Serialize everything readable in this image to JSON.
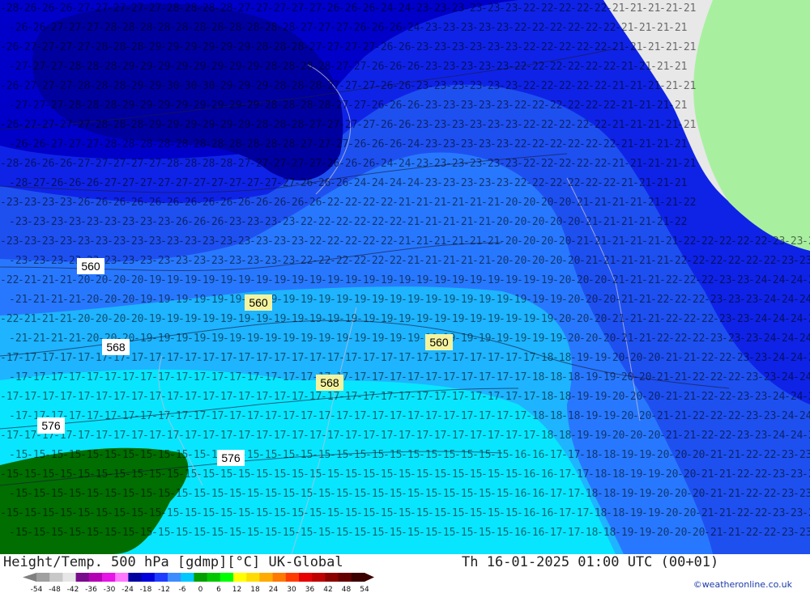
{
  "map": {
    "contour_labels": [
      {
        "text": "560",
        "style": "white"
      },
      {
        "text": "560",
        "style": "yellow"
      },
      {
        "text": "560",
        "style": "yellow"
      },
      {
        "text": "568",
        "style": "white"
      },
      {
        "text": "568",
        "style": "yellow"
      },
      {
        "text": "576",
        "style": "white"
      },
      {
        "text": "576",
        "style": "white"
      }
    ],
    "colors": {
      "temp_m30": "#00009f",
      "temp_m27": "#0000c8",
      "temp_m24": "#0f23e6",
      "temp_m21": "#1e50f0",
      "temp_m18": "#2878ff",
      "temp_m16": "#1eb4ff",
      "temp_m14": "#08e6ff",
      "land_green": "#a8f0a0",
      "land_gray": "#e8e8e8",
      "low_green": "#006e00"
    }
  },
  "footer": {
    "title": "Height/Temp. 500 hPa [gdmp][°C] UK-Global",
    "datetime": "Th 16-01-2025 01:00 UTC (00+01)",
    "credit": "©weatheronline.co.uk"
  },
  "legend": {
    "ticks": [
      "-54",
      "-48",
      "-42",
      "-36",
      "-30",
      "-24",
      "-18",
      "-12",
      "-6",
      "0",
      "6",
      "12",
      "18",
      "24",
      "30",
      "36",
      "42",
      "48",
      "54"
    ],
    "colors": [
      "#a0a0a0",
      "#c8c8c8",
      "#e6e6e6",
      "#7a0a8c",
      "#b400b4",
      "#e614e6",
      "#ff78ff",
      "#0000a0",
      "#0000dc",
      "#1e3cff",
      "#3c8cff",
      "#00c8ff",
      "#00a000",
      "#00c800",
      "#00ff00",
      "#ffff00",
      "#ffdc00",
      "#ffaa00",
      "#ff7800",
      "#ff3c00",
      "#e60000",
      "#be0000",
      "#8c0000",
      "#640000",
      "#3c0000"
    ]
  }
}
